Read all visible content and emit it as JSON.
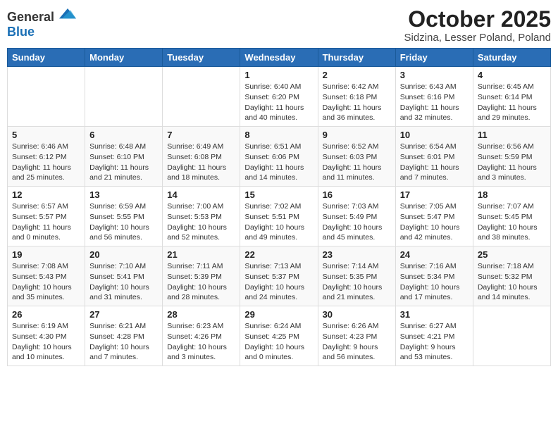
{
  "header": {
    "logo_general": "General",
    "logo_blue": "Blue",
    "month_title": "October 2025",
    "subtitle": "Sidzina, Lesser Poland, Poland"
  },
  "weekdays": [
    "Sunday",
    "Monday",
    "Tuesday",
    "Wednesday",
    "Thursday",
    "Friday",
    "Saturday"
  ],
  "weeks": [
    [
      {
        "day": "",
        "info": ""
      },
      {
        "day": "",
        "info": ""
      },
      {
        "day": "",
        "info": ""
      },
      {
        "day": "1",
        "info": "Sunrise: 6:40 AM\nSunset: 6:20 PM\nDaylight: 11 hours\nand 40 minutes."
      },
      {
        "day": "2",
        "info": "Sunrise: 6:42 AM\nSunset: 6:18 PM\nDaylight: 11 hours\nand 36 minutes."
      },
      {
        "day": "3",
        "info": "Sunrise: 6:43 AM\nSunset: 6:16 PM\nDaylight: 11 hours\nand 32 minutes."
      },
      {
        "day": "4",
        "info": "Sunrise: 6:45 AM\nSunset: 6:14 PM\nDaylight: 11 hours\nand 29 minutes."
      }
    ],
    [
      {
        "day": "5",
        "info": "Sunrise: 6:46 AM\nSunset: 6:12 PM\nDaylight: 11 hours\nand 25 minutes."
      },
      {
        "day": "6",
        "info": "Sunrise: 6:48 AM\nSunset: 6:10 PM\nDaylight: 11 hours\nand 21 minutes."
      },
      {
        "day": "7",
        "info": "Sunrise: 6:49 AM\nSunset: 6:08 PM\nDaylight: 11 hours\nand 18 minutes."
      },
      {
        "day": "8",
        "info": "Sunrise: 6:51 AM\nSunset: 6:06 PM\nDaylight: 11 hours\nand 14 minutes."
      },
      {
        "day": "9",
        "info": "Sunrise: 6:52 AM\nSunset: 6:03 PM\nDaylight: 11 hours\nand 11 minutes."
      },
      {
        "day": "10",
        "info": "Sunrise: 6:54 AM\nSunset: 6:01 PM\nDaylight: 11 hours\nand 7 minutes."
      },
      {
        "day": "11",
        "info": "Sunrise: 6:56 AM\nSunset: 5:59 PM\nDaylight: 11 hours\nand 3 minutes."
      }
    ],
    [
      {
        "day": "12",
        "info": "Sunrise: 6:57 AM\nSunset: 5:57 PM\nDaylight: 11 hours\nand 0 minutes."
      },
      {
        "day": "13",
        "info": "Sunrise: 6:59 AM\nSunset: 5:55 PM\nDaylight: 10 hours\nand 56 minutes."
      },
      {
        "day": "14",
        "info": "Sunrise: 7:00 AM\nSunset: 5:53 PM\nDaylight: 10 hours\nand 52 minutes."
      },
      {
        "day": "15",
        "info": "Sunrise: 7:02 AM\nSunset: 5:51 PM\nDaylight: 10 hours\nand 49 minutes."
      },
      {
        "day": "16",
        "info": "Sunrise: 7:03 AM\nSunset: 5:49 PM\nDaylight: 10 hours\nand 45 minutes."
      },
      {
        "day": "17",
        "info": "Sunrise: 7:05 AM\nSunset: 5:47 PM\nDaylight: 10 hours\nand 42 minutes."
      },
      {
        "day": "18",
        "info": "Sunrise: 7:07 AM\nSunset: 5:45 PM\nDaylight: 10 hours\nand 38 minutes."
      }
    ],
    [
      {
        "day": "19",
        "info": "Sunrise: 7:08 AM\nSunset: 5:43 PM\nDaylight: 10 hours\nand 35 minutes."
      },
      {
        "day": "20",
        "info": "Sunrise: 7:10 AM\nSunset: 5:41 PM\nDaylight: 10 hours\nand 31 minutes."
      },
      {
        "day": "21",
        "info": "Sunrise: 7:11 AM\nSunset: 5:39 PM\nDaylight: 10 hours\nand 28 minutes."
      },
      {
        "day": "22",
        "info": "Sunrise: 7:13 AM\nSunset: 5:37 PM\nDaylight: 10 hours\nand 24 minutes."
      },
      {
        "day": "23",
        "info": "Sunrise: 7:14 AM\nSunset: 5:35 PM\nDaylight: 10 hours\nand 21 minutes."
      },
      {
        "day": "24",
        "info": "Sunrise: 7:16 AM\nSunset: 5:34 PM\nDaylight: 10 hours\nand 17 minutes."
      },
      {
        "day": "25",
        "info": "Sunrise: 7:18 AM\nSunset: 5:32 PM\nDaylight: 10 hours\nand 14 minutes."
      }
    ],
    [
      {
        "day": "26",
        "info": "Sunrise: 6:19 AM\nSunset: 4:30 PM\nDaylight: 10 hours\nand 10 minutes."
      },
      {
        "day": "27",
        "info": "Sunrise: 6:21 AM\nSunset: 4:28 PM\nDaylight: 10 hours\nand 7 minutes."
      },
      {
        "day": "28",
        "info": "Sunrise: 6:23 AM\nSunset: 4:26 PM\nDaylight: 10 hours\nand 3 minutes."
      },
      {
        "day": "29",
        "info": "Sunrise: 6:24 AM\nSunset: 4:25 PM\nDaylight: 10 hours\nand 0 minutes."
      },
      {
        "day": "30",
        "info": "Sunrise: 6:26 AM\nSunset: 4:23 PM\nDaylight: 9 hours\nand 56 minutes."
      },
      {
        "day": "31",
        "info": "Sunrise: 6:27 AM\nSunset: 4:21 PM\nDaylight: 9 hours\nand 53 minutes."
      },
      {
        "day": "",
        "info": ""
      }
    ]
  ]
}
